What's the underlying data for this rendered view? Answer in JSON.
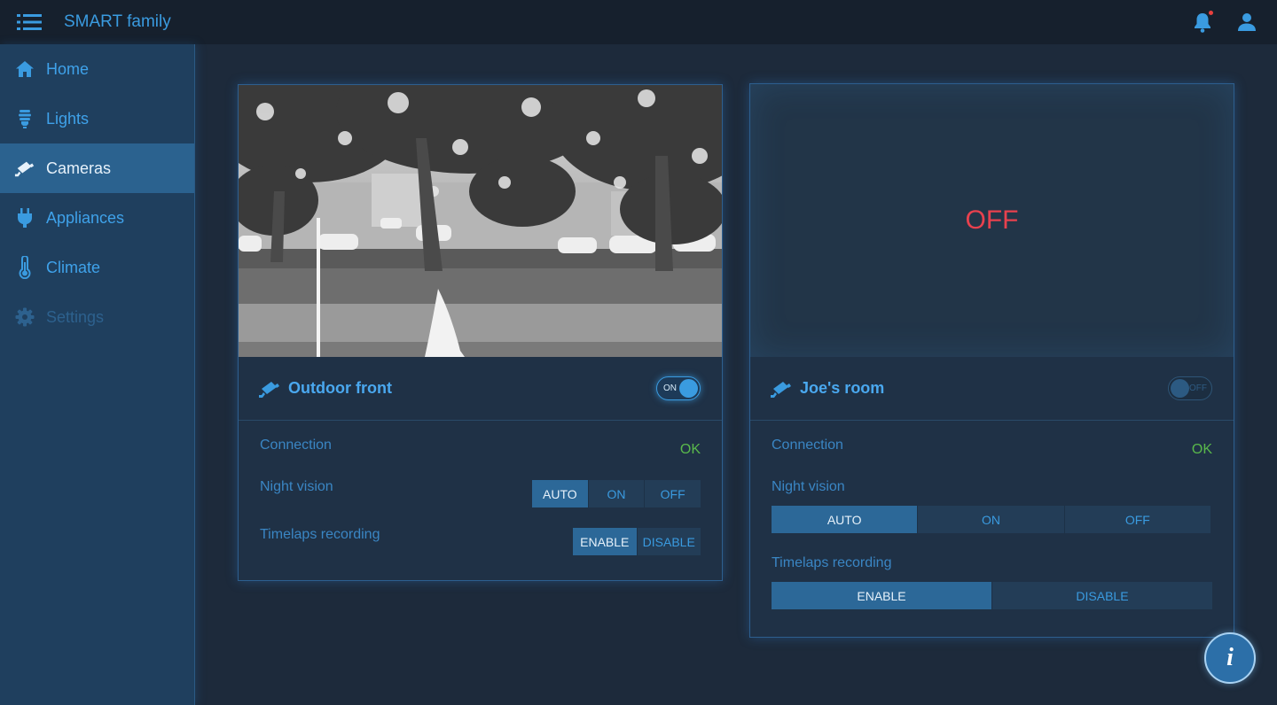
{
  "header": {
    "title": "SMART family",
    "menu_icon": "menu-icon",
    "bell_icon": "bell-icon",
    "user_icon": "user-icon"
  },
  "sidebar": {
    "items": [
      {
        "label": "Home",
        "icon": "home-icon"
      },
      {
        "label": "Lights",
        "icon": "lightbulb-icon"
      },
      {
        "label": "Cameras",
        "icon": "camera-icon"
      },
      {
        "label": "Appliances",
        "icon": "plug-icon"
      },
      {
        "label": "Climate",
        "icon": "thermometer-icon"
      },
      {
        "label": "Settings",
        "icon": "gear-icon"
      }
    ]
  },
  "cameras": [
    {
      "name": "Outdoor front",
      "power": "ON",
      "connection_label": "Connection",
      "connection_status": "OK",
      "night_vision_label": "Night vision",
      "night_vision_options": [
        "AUTO",
        "ON",
        "OFF"
      ],
      "night_vision_selected": "AUTO",
      "timelapse_label": "Timelaps recording",
      "timelapse_options": [
        "ENABLE",
        "DISABLE"
      ],
      "timelapse_selected": "ENABLE"
    },
    {
      "name": "Joe's room",
      "power": "OFF",
      "feed_text": "OFF",
      "connection_label": "Connection",
      "connection_status": "OK",
      "night_vision_label": "Night vision",
      "night_vision_options": [
        "AUTO",
        "ON",
        "OFF"
      ],
      "night_vision_selected": "AUTO",
      "timelapse_label": "Timelaps recording",
      "timelapse_options": [
        "ENABLE",
        "DISABLE"
      ],
      "timelapse_selected": "ENABLE"
    }
  ],
  "info_button": {
    "label": "i"
  },
  "colors": {
    "accent": "#3a9be0",
    "ok": "#59b84b",
    "off": "#e8414e",
    "active_nav": "#2b628f"
  }
}
